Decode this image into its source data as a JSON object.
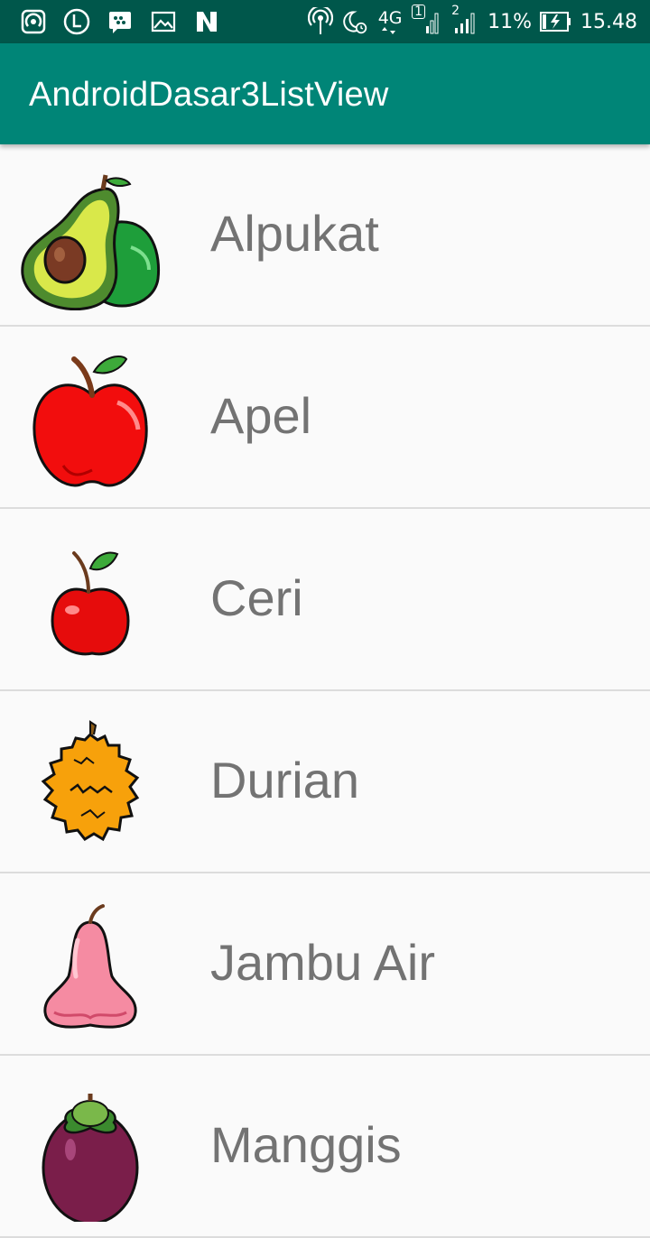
{
  "status_bar": {
    "battery": "11%",
    "time": "15.48",
    "network": "4G",
    "sim1": "1",
    "sim2": "2"
  },
  "app_bar": {
    "title": "AndroidDasar3ListView"
  },
  "fruits": [
    {
      "name": "Alpukat",
      "icon": "avocado-icon"
    },
    {
      "name": "Apel",
      "icon": "apple-icon"
    },
    {
      "name": "Ceri",
      "icon": "cherry-icon"
    },
    {
      "name": "Durian",
      "icon": "durian-icon"
    },
    {
      "name": "Jambu Air",
      "icon": "water-apple-icon"
    },
    {
      "name": "Manggis",
      "icon": "mangosteen-icon"
    }
  ],
  "colors": {
    "status_bar": "#00574B",
    "app_bar": "#008577",
    "list_text": "#737373",
    "background": "#FAFAFA"
  }
}
